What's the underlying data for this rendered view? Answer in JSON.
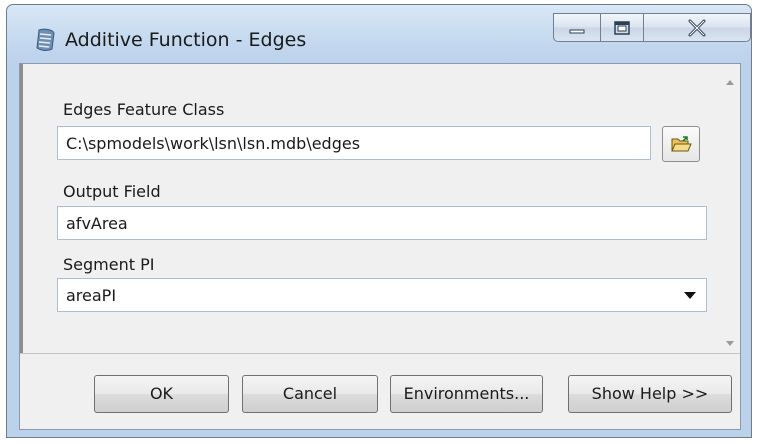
{
  "window": {
    "title": "Additive Function - Edges",
    "caption_icons": [
      "minimize-icon",
      "maximize-icon",
      "close-icon"
    ]
  },
  "params": {
    "edges_label": "Edges Feature Class",
    "edges_value": "C:\\spmodels\\work\\lsn\\lsn.mdb\\edges",
    "output_label": "Output Field",
    "output_value": "afvArea",
    "segment_label": "Segment PI",
    "segment_value": "areaPI"
  },
  "buttons": {
    "ok": "OK",
    "cancel": "Cancel",
    "environments": "Environments...",
    "help": "Show Help >>"
  },
  "colors": {
    "titlebar": "#c2d7ee",
    "panel": "#f0f0f0",
    "field_border": "#abbed3"
  }
}
